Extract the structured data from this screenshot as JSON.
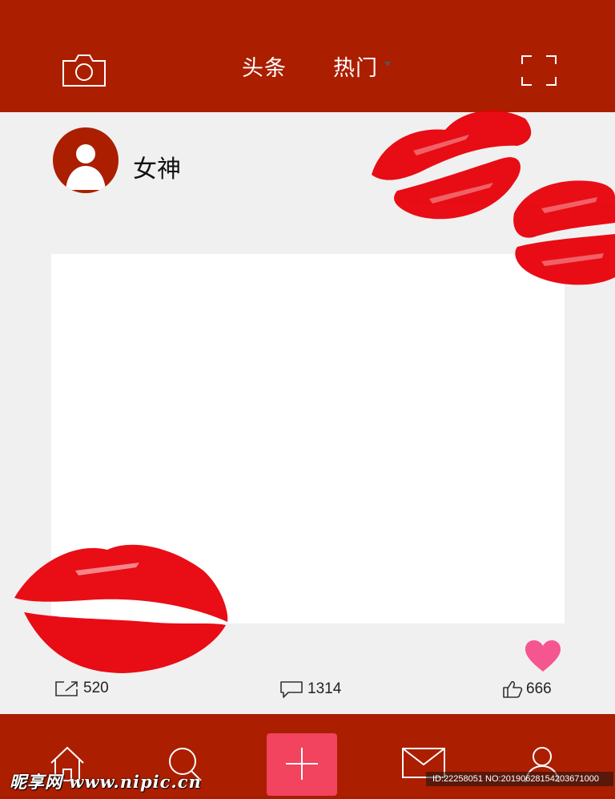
{
  "header": {
    "tabs": [
      {
        "label": "头条"
      },
      {
        "label": "热门"
      }
    ],
    "left_icon": "camera-icon",
    "right_icon": "scan-icon"
  },
  "post": {
    "username": "女神",
    "stats": {
      "share_count": "520",
      "comment_count": "1314",
      "like_count": "666"
    }
  },
  "bottom_nav": {
    "items": [
      "home-icon",
      "search-icon",
      "plus-icon",
      "mail-icon",
      "profile-icon"
    ]
  },
  "watermark": {
    "site": "昵享网 www.nipic.cn",
    "id_text": "ID:22258051 NO:20190628154203671000"
  },
  "colors": {
    "brand_red": "#ab1e00",
    "card_bg": "#f0f0f0",
    "accent_pink": "#f2435f",
    "heart": "#f5568f",
    "lipstick": "#e8000a"
  }
}
